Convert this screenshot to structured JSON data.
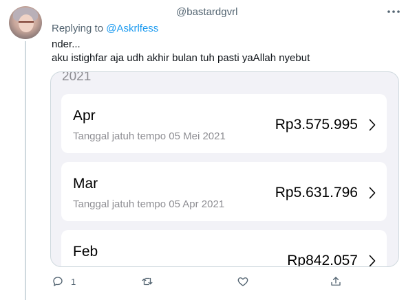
{
  "tweet": {
    "username": "@bastardgvrl",
    "replying_prefix": "Replying to ",
    "replying_mention": "@Askrlfess",
    "text_line1": "nder...",
    "text_line2": "aku istighfar aja udh akhir bulan tuh pasti yaAllah nyebut"
  },
  "media": {
    "year": "2021",
    "bills": [
      {
        "month": "Apr",
        "due": "Tanggal jatuh tempo 05 Mei 2021",
        "amount": "Rp3.575.995"
      },
      {
        "month": "Mar",
        "due": "Tanggal jatuh tempo 05 Apr 2021",
        "amount": "Rp5.631.796"
      },
      {
        "month": "Feb",
        "due": "",
        "amount": "Rp842.057"
      }
    ]
  },
  "actions": {
    "reply_count": "1",
    "icons": [
      "reply-icon",
      "retweet-icon",
      "like-icon",
      "share-icon"
    ]
  },
  "colors": {
    "accent": "#1d9bf0",
    "secondary_text": "#536471",
    "card_bg": "#f2f2f7"
  }
}
